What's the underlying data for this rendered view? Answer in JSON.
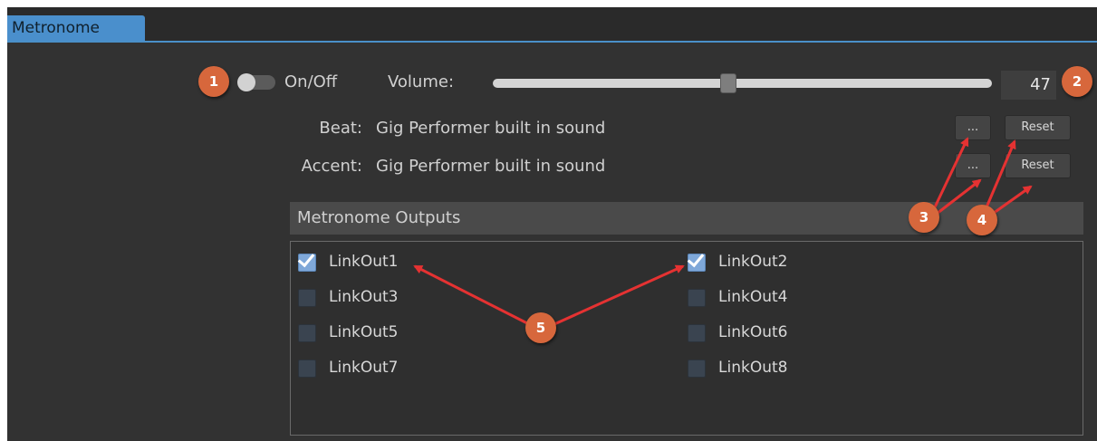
{
  "tab": {
    "label": "Metronome"
  },
  "controls": {
    "onoff_label": "On/Off",
    "on": false,
    "volume_label": "Volume:",
    "volume_value": "47",
    "volume_fraction": 0.47
  },
  "sounds": {
    "beat_label": "Beat:",
    "beat_value": "Gig Performer built in sound",
    "accent_label": "Accent:",
    "accent_value": "Gig Performer built in sound",
    "browse_label": "...",
    "reset_label": "Reset"
  },
  "outputs": {
    "title": "Metronome Outputs",
    "items": [
      {
        "label": "LinkOut1",
        "checked": true
      },
      {
        "label": "LinkOut2",
        "checked": true
      },
      {
        "label": "LinkOut3",
        "checked": false
      },
      {
        "label": "LinkOut4",
        "checked": false
      },
      {
        "label": "LinkOut5",
        "checked": false
      },
      {
        "label": "LinkOut6",
        "checked": false
      },
      {
        "label": "LinkOut7",
        "checked": false
      },
      {
        "label": "LinkOut8",
        "checked": false
      }
    ]
  },
  "annotations": {
    "badges": [
      "1",
      "2",
      "3",
      "4",
      "5"
    ],
    "arrow_color": "#e53232",
    "badge_color": "#d7673c"
  },
  "colors": {
    "accent": "#4a8fcc",
    "panel": "#323232"
  }
}
